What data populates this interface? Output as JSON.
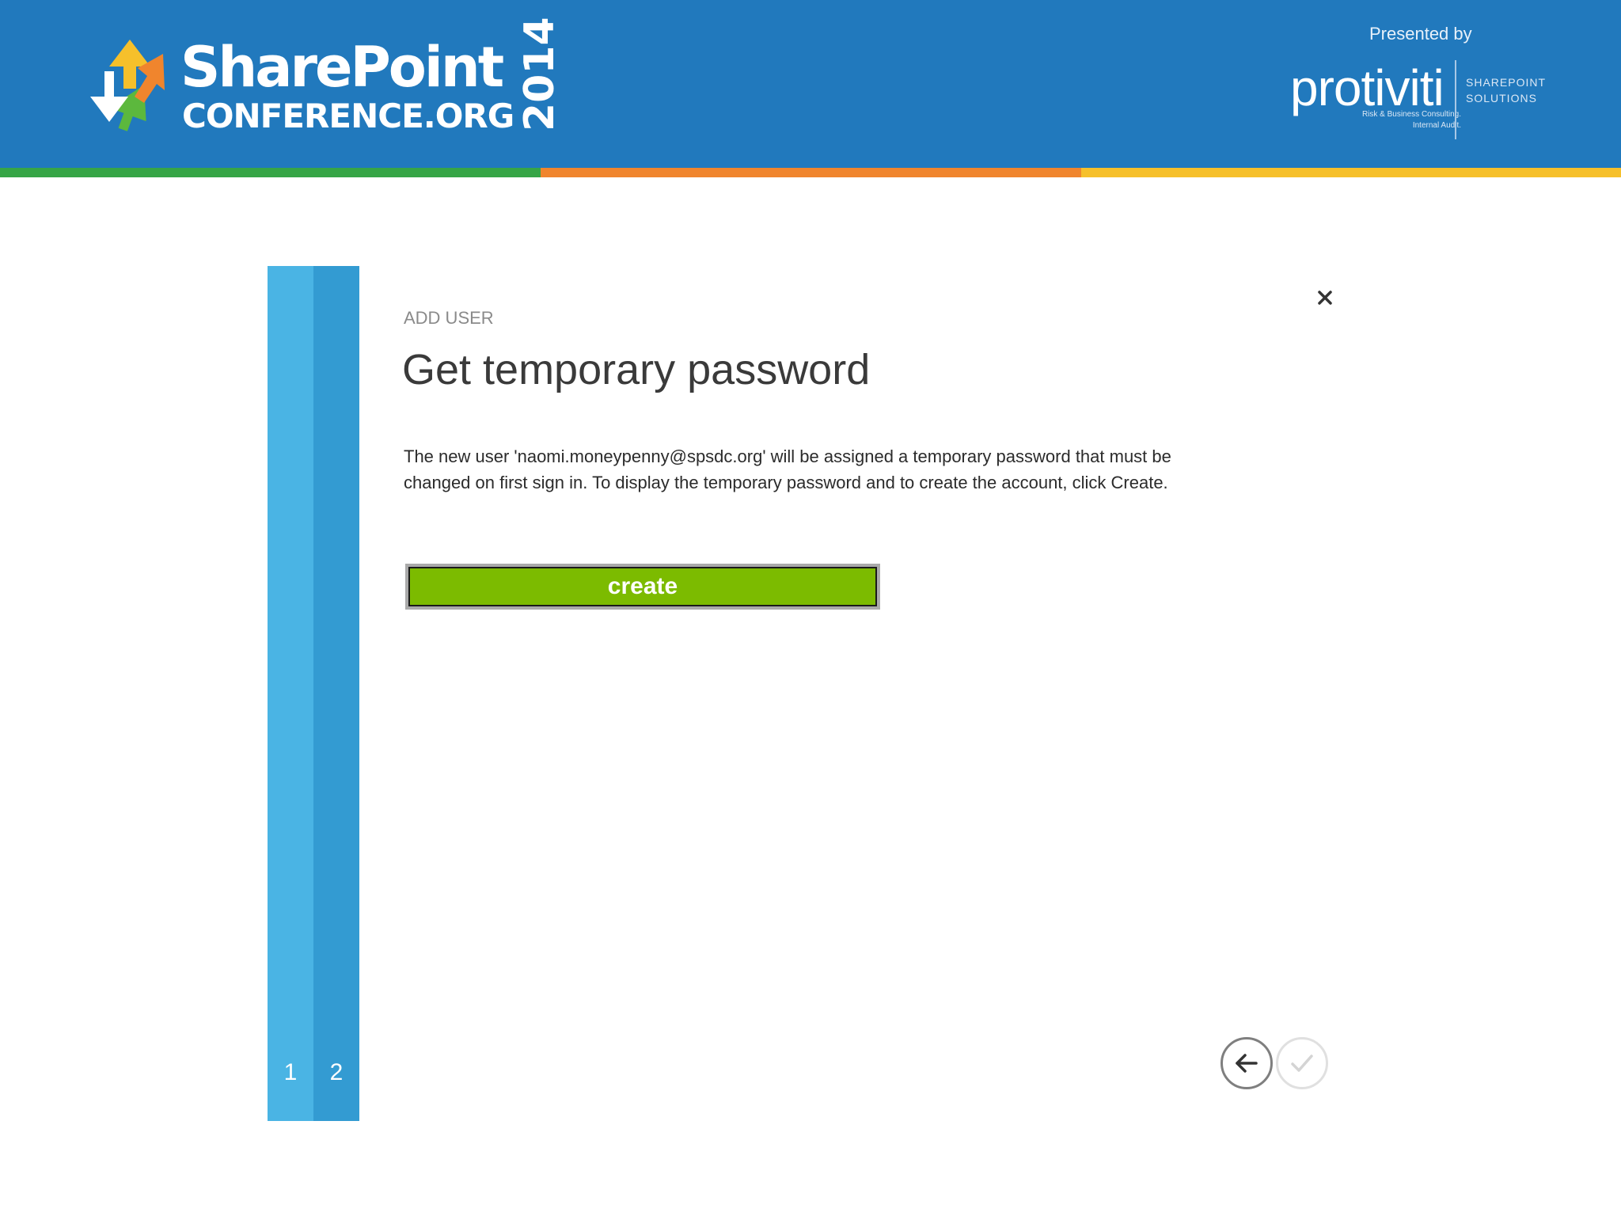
{
  "header": {
    "logo_title": "SharePoint",
    "logo_subtitle": "CONFERENCE.ORG",
    "logo_year": "2014",
    "presented_by": "Presented by",
    "sponsor_name": "protiviti",
    "sponsor_tagline": "Risk & Business Consulting.\nInternal Audit.",
    "sponsor_division": "SHAREPOINT\nSOLUTIONS"
  },
  "wizard": {
    "steps": [
      "1",
      "2"
    ],
    "eyebrow": "ADD USER",
    "title": "Get temporary password",
    "description": "The new user 'naomi.moneypenny@spsdc.org' will be assigned a temporary password that must be changed on first sign in. To display the temporary password and to create the account, click Create.",
    "create_label": "create"
  },
  "icons": {
    "close": "close-icon",
    "back": "arrow-left-icon",
    "done": "checkmark-icon"
  },
  "colors": {
    "banner": "#2179bd",
    "stripe_green": "#36a546",
    "stripe_orange": "#f0852d",
    "stripe_yellow": "#f6c02b",
    "step_one": "#4ab4e4",
    "step_two": "#339bd2",
    "create_button": "#7cbb00"
  }
}
